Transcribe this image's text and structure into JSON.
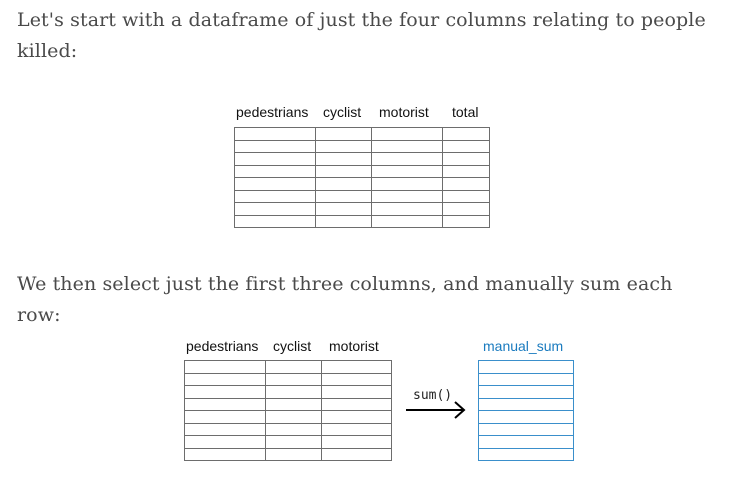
{
  "intro_text": "Let's start with a dataframe of just the four columns relating to people killed:",
  "table1": {
    "columns": [
      "pedestrians",
      "cyclist",
      "motorist",
      "total"
    ]
  },
  "middle_text": "We then select just the first three columns, and manually sum each row:",
  "table2": {
    "columns": [
      "pedestrians",
      "cyclist",
      "motorist"
    ]
  },
  "operation": {
    "label": "sum()"
  },
  "result": {
    "column": "manual_sum",
    "color": "#1a7bbf"
  }
}
